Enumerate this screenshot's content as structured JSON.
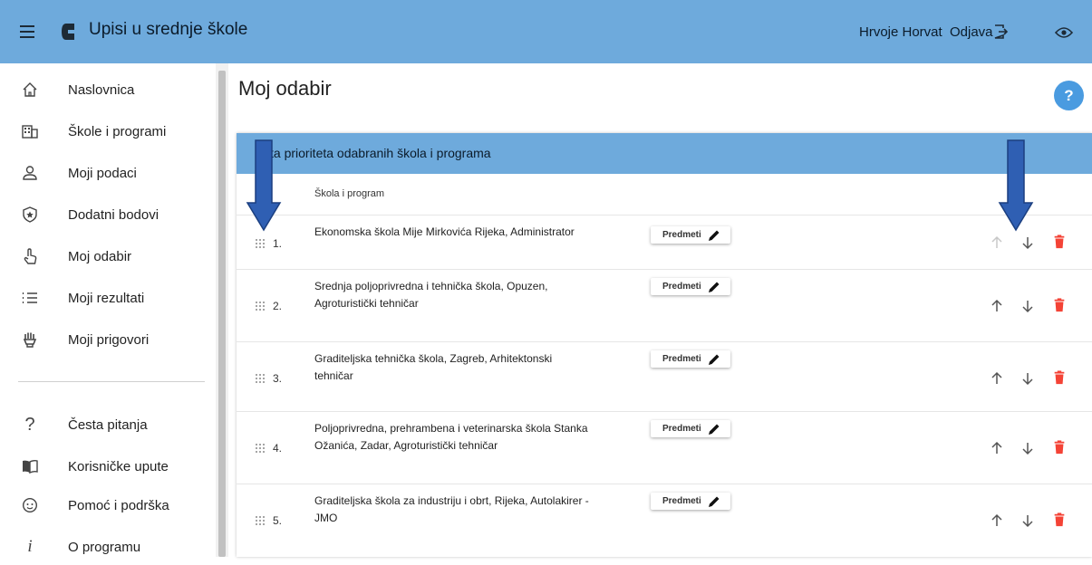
{
  "app": {
    "title": "Upisi u srednje škole"
  },
  "header": {
    "user_name": "Hrvoje Horvat",
    "logout_label": "Odjava"
  },
  "sidebar": {
    "items": [
      {
        "label": "Naslovnica",
        "icon": "home-icon"
      },
      {
        "label": "Škole i programi",
        "icon": "building-icon"
      },
      {
        "label": "Moji podaci",
        "icon": "person-icon"
      },
      {
        "label": "Dodatni bodovi",
        "icon": "star-badge-icon"
      },
      {
        "label": "Moj odabir",
        "icon": "hand-pointer-icon"
      },
      {
        "label": "Moji rezultati",
        "icon": "list-icon"
      },
      {
        "label": "Moji prigovori",
        "icon": "raised-hand-icon"
      }
    ],
    "bottom_items": [
      {
        "label": "Česta pitanja",
        "icon": "question-icon"
      },
      {
        "label": "Korisničke upute",
        "icon": "book-icon"
      },
      {
        "label": "Pomoć i podrška",
        "icon": "support-face-icon"
      },
      {
        "label": "O programu",
        "icon": "info-icon"
      }
    ]
  },
  "main": {
    "title": "Moj odabir",
    "help_label": "?",
    "card_title": "ta prioriteta odabranih škola i programa",
    "column_header": "Škola i program",
    "predmeti_label": "Predmeti",
    "rows": [
      {
        "num": "1.",
        "line1": "Ekonomska škola Mije Mirkovića Rijeka, Administrator",
        "line2": ""
      },
      {
        "num": "2.",
        "line1": "Srednja poljoprivredna i tehnička škola, Opuzen,",
        "line2": "Agroturistički tehničar"
      },
      {
        "num": "3.",
        "line1": "Graditeljska tehnička škola, Zagreb, Arhitektonski",
        "line2": "tehničar"
      },
      {
        "num": "4.",
        "line1": "Poljoprivredna, prehrambena i veterinarska škola Stanka",
        "line2": "Ožanića, Zadar, Agroturistički tehničar"
      },
      {
        "num": "5.",
        "line1": "Graditeljska škola za industriju i obrt, Rijeka, Autolakirer -",
        "line2": "JMO"
      }
    ]
  },
  "colors": {
    "header_blue": "#6eaadc",
    "delete_red": "#f44336",
    "annotation_blue": "#2f5fb3",
    "help_blue": "#4a9be0"
  }
}
